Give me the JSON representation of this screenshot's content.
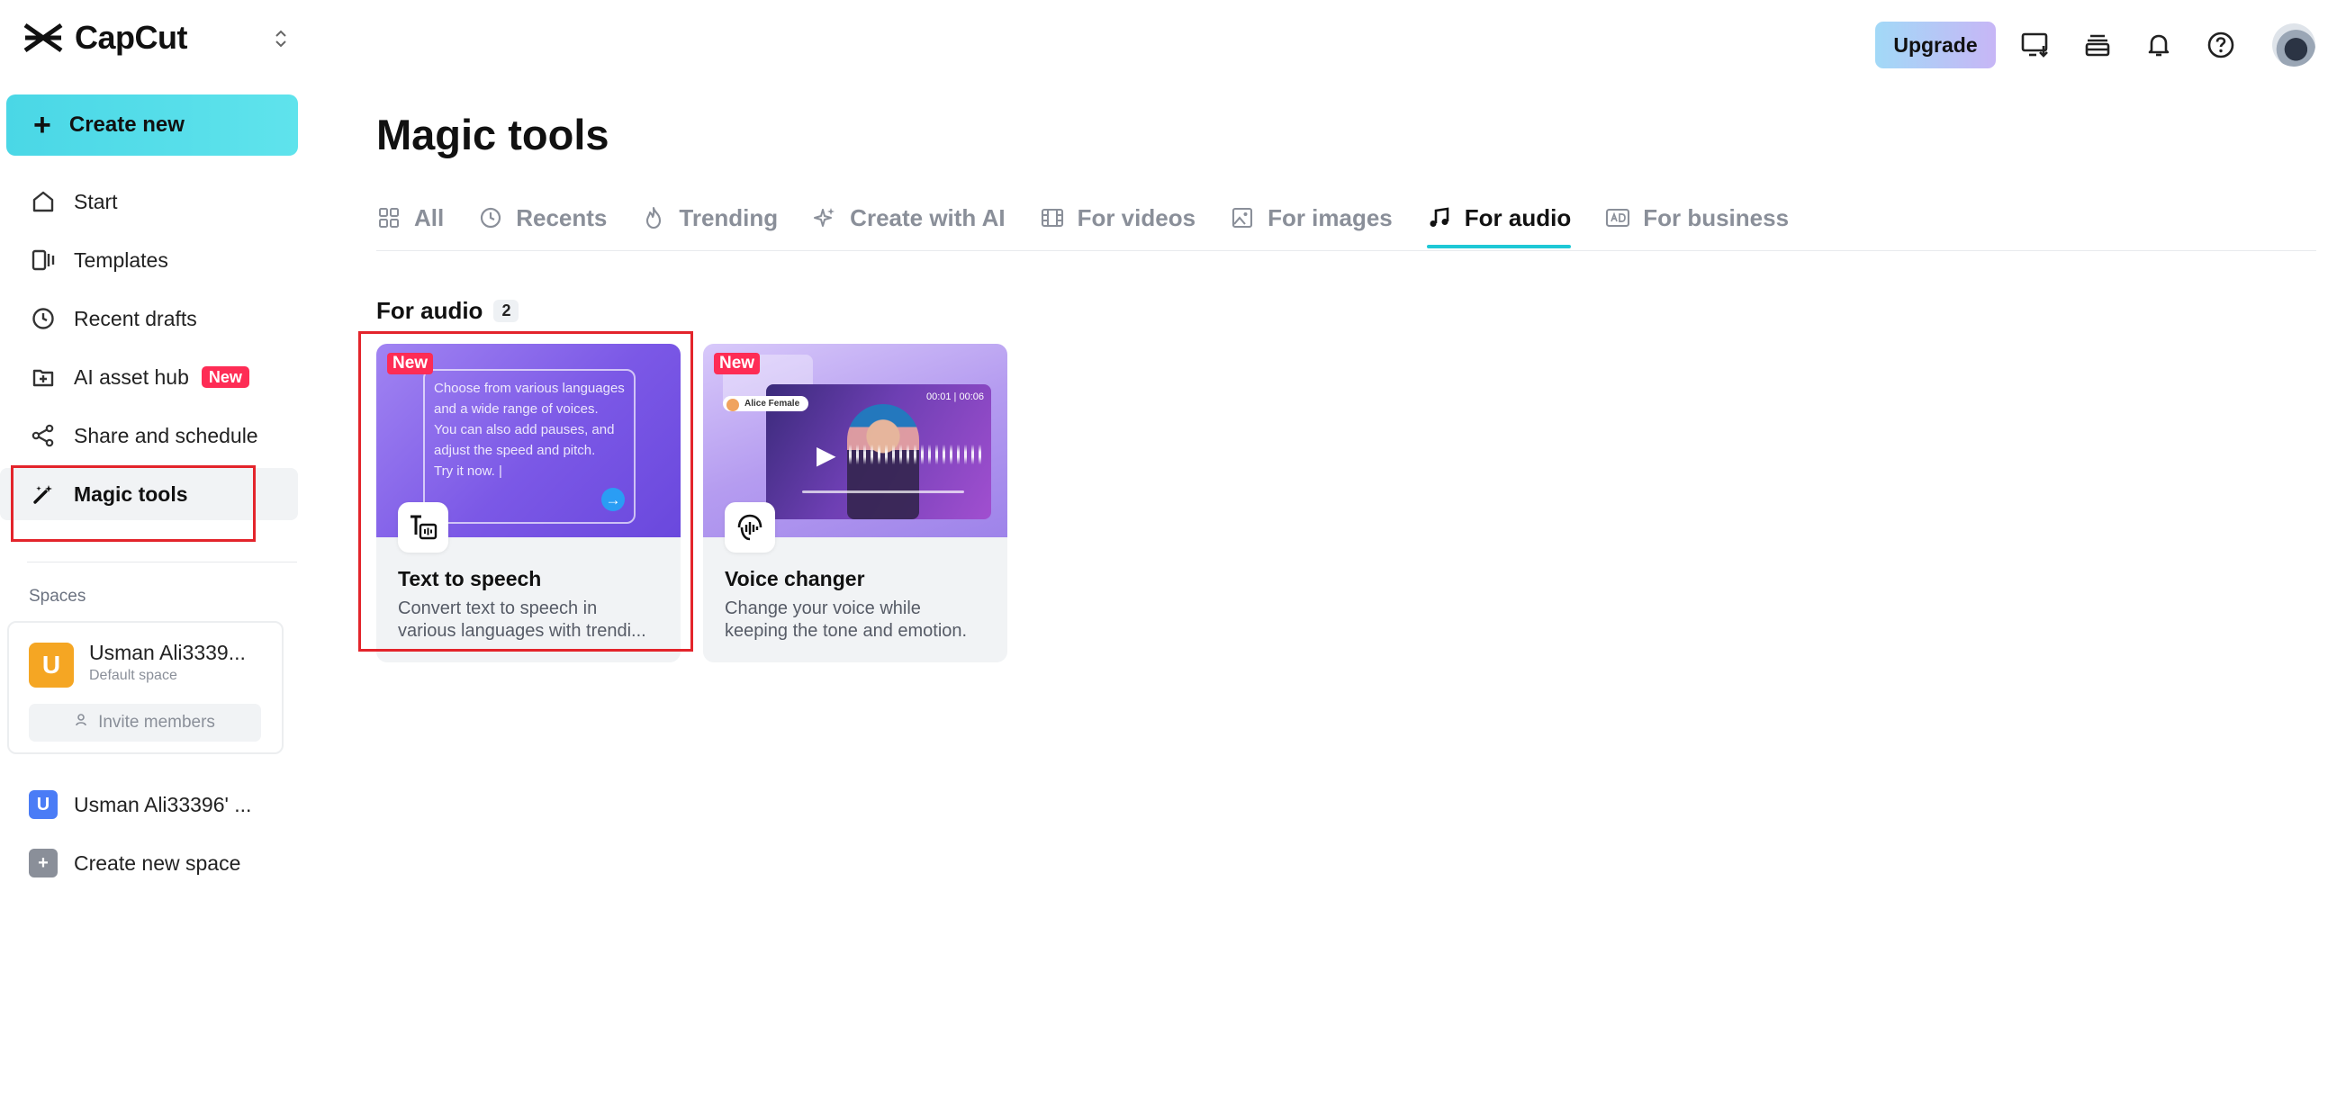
{
  "app": {
    "name": "CapCut"
  },
  "sidebar": {
    "create_label": "Create new",
    "items": [
      {
        "label": "Start",
        "icon": "home-icon"
      },
      {
        "label": "Templates",
        "icon": "templates-icon"
      },
      {
        "label": "Recent drafts",
        "icon": "clock-icon"
      },
      {
        "label": "AI asset hub",
        "icon": "asset-hub-icon",
        "badge": "New"
      },
      {
        "label": "Share and schedule",
        "icon": "share-icon"
      },
      {
        "label": "Magic tools",
        "icon": "magic-wand-icon",
        "active": true
      }
    ],
    "spaces_label": "Spaces",
    "space_card": {
      "initial": "U",
      "name": "Usman Ali3339...",
      "sub": "Default space",
      "invite_label": "Invite members"
    },
    "space_rows": [
      {
        "initial": "U",
        "label": "Usman Ali33396' ...",
        "color": "#4a7cf6"
      },
      {
        "initial": "+",
        "label": "Create new space",
        "color": "#8a8f99"
      }
    ]
  },
  "topbar": {
    "upgrade_label": "Upgrade",
    "icons": [
      "monitor-download-icon",
      "stack-icon",
      "bell-icon",
      "help-icon",
      "user-avatar"
    ]
  },
  "main": {
    "title": "Magic tools",
    "tabs": [
      {
        "label": "All",
        "icon": "grid-icon"
      },
      {
        "label": "Recents",
        "icon": "clock-icon"
      },
      {
        "label": "Trending",
        "icon": "flame-icon"
      },
      {
        "label": "Create with AI",
        "icon": "sparkle-icon"
      },
      {
        "label": "For videos",
        "icon": "film-icon"
      },
      {
        "label": "For images",
        "icon": "image-icon"
      },
      {
        "label": "For audio",
        "icon": "music-icon",
        "active": true
      },
      {
        "label": "For business",
        "icon": "ad-icon"
      }
    ],
    "section": {
      "title": "For audio",
      "count": "2"
    },
    "cards": [
      {
        "badge": "New",
        "title": "Text to speech",
        "desc_line1": "Convert text to speech in",
        "desc_line2": "various languages with trendi...",
        "thumb_text": [
          "Choose from various languages",
          "and a wide range of voices.",
          "You can also add pauses, and",
          "adjust the speed and pitch.",
          "Try it now. |"
        ]
      },
      {
        "badge": "New",
        "title": "Voice changer",
        "desc_line1": "Change your voice while",
        "desc_line2": "keeping the tone and emotion.",
        "thumb_time": "00:01 | 00:06",
        "thumb_tag": "Alice Female"
      }
    ]
  },
  "colors": {
    "accent": "#1ec8d6",
    "create_btn": "#4ad7e6",
    "badge_red": "#fe2c55",
    "highlight": "#e3242b"
  }
}
